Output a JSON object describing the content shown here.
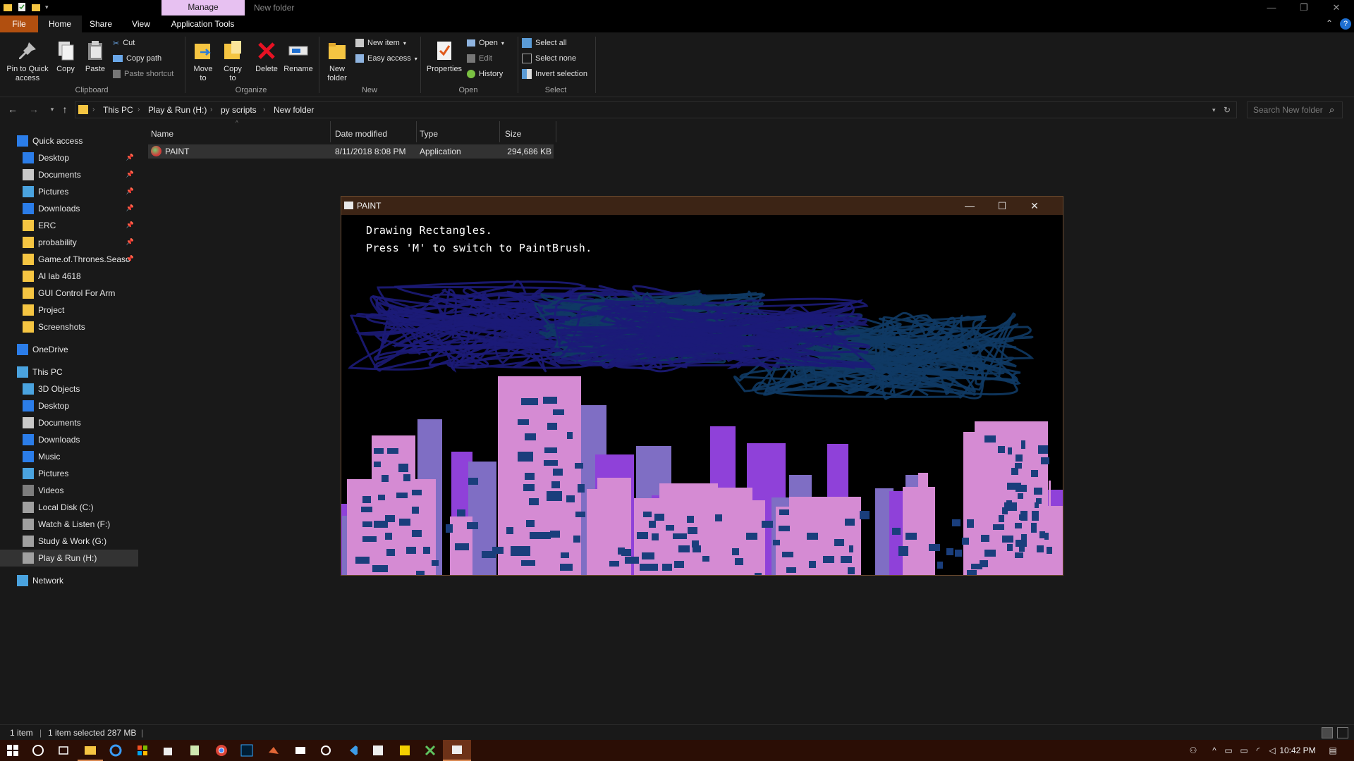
{
  "title_bar": {
    "manage_label": "Manage",
    "window_title": "New folder"
  },
  "tabs": {
    "file": "File",
    "home": "Home",
    "share": "Share",
    "view": "View",
    "app_tools": "Application Tools"
  },
  "ribbon": {
    "clipboard": {
      "group": "Clipboard",
      "pin": "Pin to Quick access",
      "copy": "Copy",
      "paste": "Paste",
      "cut": "Cut",
      "copy_path": "Copy path",
      "paste_shortcut": "Paste shortcut"
    },
    "organize": {
      "group": "Organize",
      "move_to": "Move to",
      "copy_to": "Copy to",
      "delete": "Delete",
      "rename": "Rename"
    },
    "new": {
      "group": "New",
      "new_folder": "New folder",
      "new_item": "New item",
      "easy_access": "Easy access"
    },
    "open": {
      "group": "Open",
      "properties": "Properties",
      "open": "Open",
      "edit": "Edit",
      "history": "History"
    },
    "select": {
      "group": "Select",
      "select_all": "Select all",
      "select_none": "Select none",
      "invert_selection": "Invert selection"
    }
  },
  "address": {
    "crumbs": [
      "This PC",
      "Play & Run (H:)",
      "py scripts",
      "New folder"
    ],
    "search_placeholder": "Search New folder"
  },
  "nav": {
    "quick_access": "Quick access",
    "quick_items": [
      "Desktop",
      "Documents",
      "Pictures",
      "Downloads",
      "ERC",
      "probability",
      "Game.of.Thrones.Seaso",
      "AI lab 4618",
      "GUI Control For Arm",
      "Project",
      "Screenshots"
    ],
    "onedrive": "OneDrive",
    "this_pc": "This PC",
    "pc_items": [
      "3D Objects",
      "Desktop",
      "Documents",
      "Downloads",
      "Music",
      "Pictures",
      "Videos",
      "Local Disk (C:)",
      "Watch & Listen (F:)",
      "Study & Work  (G:)",
      "Play & Run (H:)"
    ],
    "network": "Network"
  },
  "columns": {
    "name": "Name",
    "date": "Date modified",
    "type": "Type",
    "size": "Size"
  },
  "files": [
    {
      "name": "PAINT",
      "date": "8/11/2018 8:08 PM",
      "type": "Application",
      "size": "294,686 KB"
    }
  ],
  "status": {
    "count": "1 item",
    "selected": "1 item selected  287 MB"
  },
  "paint": {
    "title": "PAINT",
    "line1": "Drawing Rectangles.",
    "line2": "Press 'M' to switch to PaintBrush."
  },
  "clock": "10:42 PM",
  "colors": {
    "pink": "#d58bd3",
    "purple": "#8f41d9",
    "violet": "#7f6ec4",
    "window": "#1a3e7c",
    "scribble1": "#1c1b78",
    "scribble2": "#103a64",
    "file_tab": "#b14f0f",
    "manage": "#e7c1f1"
  }
}
